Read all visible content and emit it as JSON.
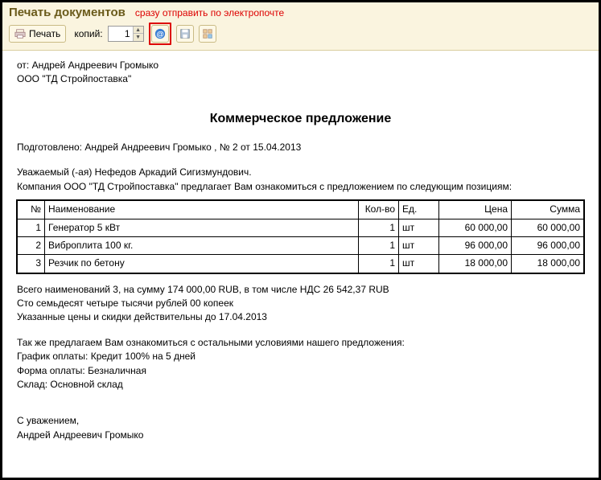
{
  "header": {
    "title": "Печать документов",
    "red_note": "сразу отправить по электропочте"
  },
  "toolbar": {
    "print_label": "Печать",
    "copies_label": "копий:",
    "copies_value": "1"
  },
  "doc": {
    "from_line": "от: Андрей Андреевич Громыко",
    "org_line": "ООО \"ТД Стройпоставка\"",
    "title": "Коммерческое предложение",
    "prepared": "Подготовлено: Андрей Андреевич Громыко , № 2 от 15.04.2013",
    "dear": "Уважаемый (-ая) Нефедов Аркадий Сигизмундович.",
    "intro": "Компания ООО \"ТД Стройпоставка\" предлагает Вам ознакомиться с предложением по следующим позициям:",
    "table_headers": {
      "num": "№",
      "name": "Наименование",
      "qty": "Кол-во",
      "unit": "Ед.",
      "price": "Цена",
      "sum": "Сумма"
    },
    "rows": [
      {
        "num": "1",
        "name": "Генератор 5 кВт",
        "qty": "1",
        "unit": "шт",
        "price": "60 000,00",
        "sum": "60 000,00"
      },
      {
        "num": "2",
        "name": "Виброплита 100 кг.",
        "qty": "1",
        "unit": "шт",
        "price": "96 000,00",
        "sum": "96 000,00"
      },
      {
        "num": "3",
        "name": "Резчик по бетону",
        "qty": "1",
        "unit": "шт",
        "price": "18 000,00",
        "sum": "18 000,00"
      }
    ],
    "total_line": "Всего наименований 3, на сумму 174 000,00 RUB, в том числе НДС 26 542,37 RUB",
    "total_words": "Сто семьдесят четыре тысячи рублей 00 копеек",
    "valid_until": "Указанные цены и скидки действительны до 17.04.2013",
    "extra_intro": "Так же предлагаем Вам ознакомиться с остальными условиями нашего предложения:",
    "pay_schedule": "График оплаты: Кредит 100% на 5 дней",
    "pay_form": "Форма оплаты: Безналичная",
    "warehouse": "Склад: Основной склад",
    "regards": "С уважением,",
    "signature": "Андрей Андреевич Громыко"
  }
}
